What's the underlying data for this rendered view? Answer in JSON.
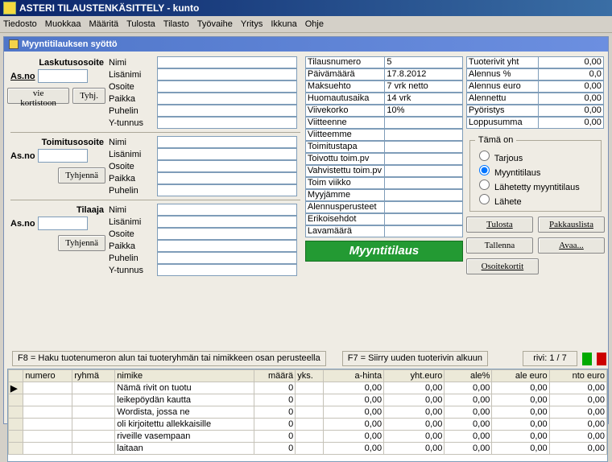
{
  "app_title": "ASTERI TILAUSTENKÄSITTELY - kunto",
  "menus": [
    "Tiedosto",
    "Muokkaa",
    "Määritä",
    "Tulosta",
    "Tilasto",
    "Työvaihe",
    "Yritys",
    "Ikkuna",
    "Ohje"
  ],
  "subwindow_title": "Myyntitilauksen syöttö",
  "sections": {
    "laskutus": {
      "title": "Laskutusosoite",
      "asno_label": "As.no",
      "asno_value": "",
      "btn_korti": "vie kortistoon",
      "btn_tyhj": "Tyhj.",
      "fields": [
        "Nimi",
        "Lisänimi",
        "Osoite",
        "Paikka",
        "Puhelin",
        "Y-tunnus"
      ]
    },
    "toimitus": {
      "title": "Toimitusosoite",
      "asno_label": "As.no",
      "asno_value": "",
      "btn_tyhj": "Tyhjennä",
      "fields": [
        "Nimi",
        "Lisänimi",
        "Osoite",
        "Paikka",
        "Puhelin"
      ]
    },
    "tilaaja": {
      "title": "Tilaaja",
      "asno_label": "As.no",
      "asno_value": "",
      "btn_tyhj": "Tyhjennä",
      "fields": [
        "Nimi",
        "Lisänimi",
        "Osoite",
        "Paikka",
        "Puhelin",
        "Y-tunnus"
      ]
    }
  },
  "order": {
    "rows": [
      {
        "k": "Tilausnumero",
        "v": "5"
      },
      {
        "k": "Päivämäärä",
        "v": "17.8.2012"
      },
      {
        "k": "Maksuehto",
        "v": "7 vrk netto"
      },
      {
        "k": "Huomautusaika",
        "v": "14 vrk"
      },
      {
        "k": "Viivekorko",
        "v": "10%"
      },
      {
        "k": "Viitteenne",
        "v": ""
      },
      {
        "k": "Viitteemme",
        "v": ""
      },
      {
        "k": "Toimitustapa",
        "v": ""
      },
      {
        "k": "Toivottu toim.pv",
        "v": ""
      },
      {
        "k": "Vahvistettu toim.pv",
        "v": ""
      },
      {
        "k": "Toim viikko",
        "v": ""
      },
      {
        "k": "Myyjämme",
        "v": ""
      },
      {
        "k": "Alennusperusteet",
        "v": ""
      },
      {
        "k": "Erikoisehdot",
        "v": ""
      },
      {
        "k": "Lavamäärä",
        "v": ""
      }
    ],
    "big_label": "Myyntitilaus"
  },
  "totals": {
    "rows": [
      {
        "k": "Tuoterivit yht",
        "v": "0,00"
      },
      {
        "k": "Alennus %",
        "v": "0,0"
      },
      {
        "k": "Alennus euro",
        "v": "0,00"
      },
      {
        "k": "Alennettu",
        "v": "0,00"
      },
      {
        "k": "Pyöristys",
        "v": "0,00"
      },
      {
        "k": "Loppusumma",
        "v": "0,00"
      }
    ]
  },
  "type": {
    "legend": "Tämä on",
    "options": [
      "Tarjous",
      "Myyntitilaus",
      "Lähetetty myyntitilaus",
      "Lähete"
    ],
    "selected": 1
  },
  "buttons": {
    "tulosta": "Tulosta",
    "pakkaus": "Pakkauslista",
    "tallenna": "Tallenna",
    "avaa": "Avaa...",
    "osoite": "Osoitekortit"
  },
  "hints": {
    "f8": "F8 = Haku tuotenumeron alun tai tuoteryhmän tai nimikkeen osan perusteella",
    "f7": "F7 = Siirry uuden tuoterivin alkuun",
    "rivi": "rivi: 1 / 7"
  },
  "grid": {
    "cols": [
      "",
      "numero",
      "ryhmä",
      "nimike",
      "määrä",
      "yks.",
      "a-hinta",
      "yht.euro",
      "ale%",
      "ale euro",
      "nto euro"
    ],
    "rows": [
      {
        "numero": "",
        "ryhma": "",
        "nimike": "Nämä rivit on tuotu",
        "maara": "0",
        "yks": "",
        "ahinta": "0,00",
        "yht": "0,00",
        "alep": "0,00",
        "alee": "0,00",
        "nto": "0,00"
      },
      {
        "numero": "",
        "ryhma": "",
        "nimike": "leikepöydän kautta",
        "maara": "0",
        "yks": "",
        "ahinta": "0,00",
        "yht": "0,00",
        "alep": "0,00",
        "alee": "0,00",
        "nto": "0,00"
      },
      {
        "numero": "",
        "ryhma": "",
        "nimike": "Wordista, jossa ne",
        "maara": "0",
        "yks": "",
        "ahinta": "0,00",
        "yht": "0,00",
        "alep": "0,00",
        "alee": "0,00",
        "nto": "0,00"
      },
      {
        "numero": "",
        "ryhma": "",
        "nimike": "oli kirjoitettu allekkaisille",
        "maara": "0",
        "yks": "",
        "ahinta": "0,00",
        "yht": "0,00",
        "alep": "0,00",
        "alee": "0,00",
        "nto": "0,00"
      },
      {
        "numero": "",
        "ryhma": "",
        "nimike": "riveille vasempaan",
        "maara": "0",
        "yks": "",
        "ahinta": "0,00",
        "yht": "0,00",
        "alep": "0,00",
        "alee": "0,00",
        "nto": "0,00"
      },
      {
        "numero": "",
        "ryhma": "",
        "nimike": "laitaan",
        "maara": "0",
        "yks": "",
        "ahinta": "0,00",
        "yht": "0,00",
        "alep": "0,00",
        "alee": "0,00",
        "nto": "0,00"
      }
    ]
  }
}
